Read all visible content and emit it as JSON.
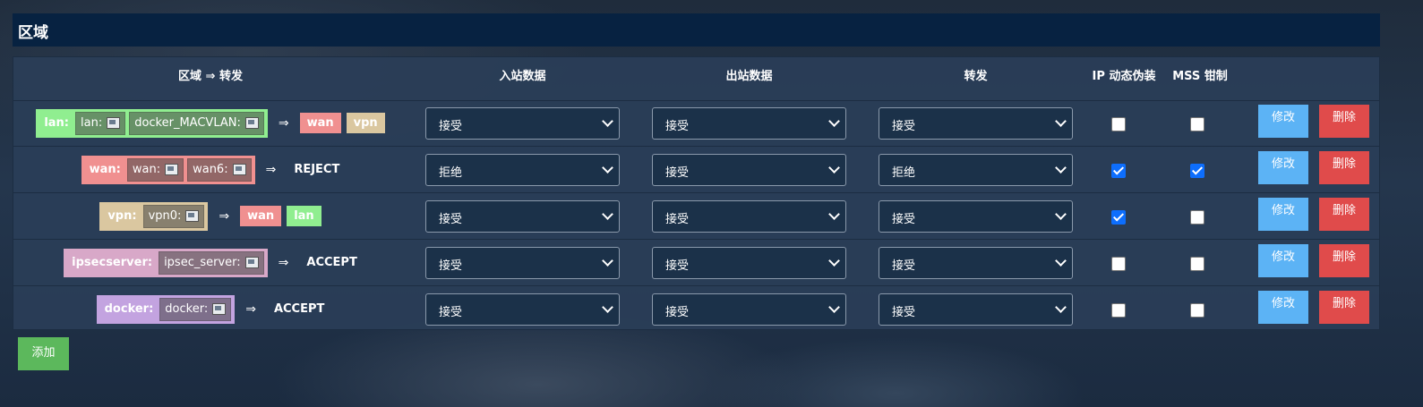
{
  "header": {
    "title": "区域"
  },
  "columns": {
    "zone_forward": "区域 ⇒ 转发",
    "input": "入站数据",
    "output": "出站数据",
    "forward": "转发",
    "masq": "IP 动态伪装",
    "mss": "MSS 钳制"
  },
  "colors": {
    "lan": "#90ee90",
    "wan": "#f09090",
    "vpn": "#dac7a0",
    "ipsecserver": "#d8a8c8",
    "docker": "#c3a3e0",
    "edit": "#5cb3f5",
    "delete": "#e04b4b",
    "add": "#5cb85c"
  },
  "rows": [
    {
      "zone": "lan:",
      "devices": [
        {
          "label": "lan:",
          "icon": "network-device-icon"
        },
        {
          "label": "docker_MACVLAN:",
          "icon": "network-device-icon"
        }
      ],
      "arrow": "⇒",
      "targets": [
        "wan",
        "vpn"
      ],
      "input": "接受",
      "output": "接受",
      "forward": "接受",
      "masq": false,
      "mss": false,
      "edit": "修改",
      "delete": "删除"
    },
    {
      "zone": "wan:",
      "devices": [
        {
          "label": "wan:",
          "icon": "network-device-icon"
        },
        {
          "label": "wan6:",
          "icon": "network-device-icon"
        }
      ],
      "arrow": "⇒",
      "policy": "REJECT",
      "input": "拒绝",
      "output": "接受",
      "forward": "拒绝",
      "masq": true,
      "mss": true,
      "edit": "修改",
      "delete": "删除"
    },
    {
      "zone": "vpn:",
      "devices": [
        {
          "label": "vpn0:",
          "icon": "network-device-icon"
        }
      ],
      "arrow": "⇒",
      "targets": [
        "wan",
        "lan"
      ],
      "input": "接受",
      "output": "接受",
      "forward": "接受",
      "masq": true,
      "mss": false,
      "edit": "修改",
      "delete": "删除"
    },
    {
      "zone": "ipsecserver:",
      "devices": [
        {
          "label": "ipsec_server:",
          "icon": "network-device-icon"
        }
      ],
      "arrow": "⇒",
      "policy": "ACCEPT",
      "input": "接受",
      "output": "接受",
      "forward": "接受",
      "masq": false,
      "mss": false,
      "edit": "修改",
      "delete": "删除"
    },
    {
      "zone": "docker:",
      "devices": [
        {
          "label": "docker:",
          "icon": "network-device-icon"
        }
      ],
      "arrow": "⇒",
      "policy": "ACCEPT",
      "input": "接受",
      "output": "接受",
      "forward": "接受",
      "masq": false,
      "mss": false,
      "edit": "修改",
      "delete": "删除"
    }
  ],
  "add_button": "添加"
}
